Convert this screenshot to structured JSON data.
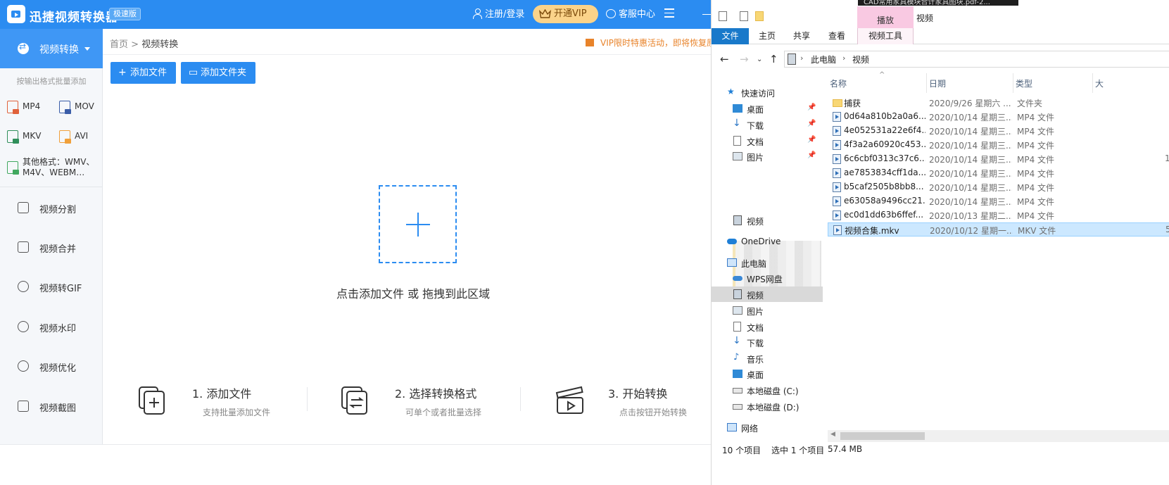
{
  "converter": {
    "app_title": "迅捷视频转换器",
    "edition_badge": "极速版",
    "header": {
      "login_label": "注册/登录",
      "vip_label": "开通VIP",
      "service_label": "客服中心"
    },
    "sidebar": {
      "main_label": "视频转换",
      "hint": "按输出格式批量添加",
      "formats": [
        {
          "label": "MP4"
        },
        {
          "label": "MOV"
        },
        {
          "label": "MKV"
        },
        {
          "label": "AVI"
        },
        {
          "label_line1": "其他格式：WMV、",
          "label_line2": "M4V、WEBM…"
        }
      ],
      "nav": [
        {
          "label": "视频分割"
        },
        {
          "label": "视频合并"
        },
        {
          "label": "视频转GIF"
        },
        {
          "label": "视频水印"
        },
        {
          "label": "视频优化"
        },
        {
          "label": "视频截图"
        }
      ]
    },
    "breadcrumb": {
      "home": "首页",
      "separator": ">",
      "current": "视频转换"
    },
    "promo": "VIP限时特惠活动，即将恢复原价",
    "buttons": {
      "add_file": "添加文件",
      "add_folder": "添加文件夹"
    },
    "drop_text": "点击添加文件 或 拖拽到此区域",
    "steps": [
      {
        "title": "1. 添加文件",
        "desc": "支持批量添加文件"
      },
      {
        "title": "2. 选择转换格式",
        "desc": "可单个或者批量选择"
      },
      {
        "title": "3. 开始转换",
        "desc": "点击按钮开始转换"
      }
    ],
    "colors": {
      "brand": "#2b8cf1",
      "vip": "#fbd38a",
      "promo": "#e8832a"
    }
  },
  "explorer": {
    "background_window_title": "CAD常用家具模块合计家具图块.pdf-2...",
    "ribbon_context_label": "播放",
    "window_title": "视频",
    "tabs": {
      "file": "文件",
      "home": "主页",
      "share": "共享",
      "view": "查看",
      "video_tools": "视频工具"
    },
    "address": {
      "parts": [
        "此电脑",
        "视频"
      ]
    },
    "nav": {
      "quick_access": "快速访问",
      "quick_items": [
        {
          "label": "桌面"
        },
        {
          "label": "下载"
        },
        {
          "label": "文档"
        },
        {
          "label": "图片"
        }
      ],
      "quick_video": "视频",
      "onedrive": "OneDrive",
      "this_pc": "此电脑",
      "pc_items": [
        {
          "label": "WPS网盘"
        },
        {
          "label": "视频"
        },
        {
          "label": "图片"
        },
        {
          "label": "文档"
        },
        {
          "label": "下载"
        },
        {
          "label": "音乐"
        },
        {
          "label": "桌面"
        },
        {
          "label": "本地磁盘 (C:)"
        },
        {
          "label": "本地磁盘 (D:)"
        }
      ],
      "network": "网络"
    },
    "columns": {
      "name": "名称",
      "date": "日期",
      "type": "类型",
      "size": "大"
    },
    "files": [
      {
        "name": "捕获",
        "date": "2020/9/26 星期六 ...",
        "type": "文件夹",
        "size": "",
        "kind": "folder"
      },
      {
        "name": "0d64a810b2a0a6...",
        "date": "2020/10/14 星期三...",
        "type": "MP4 文件",
        "size": "",
        "kind": "video"
      },
      {
        "name": "4e052531a22e6f4...",
        "date": "2020/10/14 星期三...",
        "type": "MP4 文件",
        "size": "",
        "kind": "video"
      },
      {
        "name": "4f3a2a60920c453...",
        "date": "2020/10/14 星期三...",
        "type": "MP4 文件",
        "size": "",
        "kind": "video"
      },
      {
        "name": "6c6cbf0313c37c6...",
        "date": "2020/10/14 星期三...",
        "type": "MP4 文件",
        "size": "1",
        "kind": "video"
      },
      {
        "name": "ae7853834cff1da...",
        "date": "2020/10/14 星期三...",
        "type": "MP4 文件",
        "size": "",
        "kind": "video"
      },
      {
        "name": "b5caf2505b8bb8...",
        "date": "2020/10/14 星期三...",
        "type": "MP4 文件",
        "size": "",
        "kind": "video"
      },
      {
        "name": "e63058a9496cc21...",
        "date": "2020/10/14 星期三...",
        "type": "MP4 文件",
        "size": "",
        "kind": "video"
      },
      {
        "name": "ec0d1dd63b6ffef...",
        "date": "2020/10/13 星期二...",
        "type": "MP4 文件",
        "size": "",
        "kind": "video"
      },
      {
        "name": "视频合集.mkv",
        "date": "2020/10/12 星期一...",
        "type": "MKV 文件",
        "size": "5",
        "kind": "video",
        "selected": true
      }
    ],
    "status": {
      "count": "10 个项目",
      "selected": "选中 1 个项目",
      "size": "57.4 MB"
    }
  }
}
